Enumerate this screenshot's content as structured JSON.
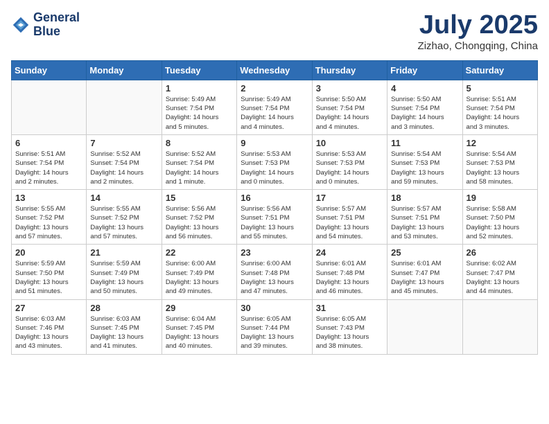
{
  "header": {
    "logo_line1": "General",
    "logo_line2": "Blue",
    "month": "July 2025",
    "location": "Zizhao, Chongqing, China"
  },
  "weekdays": [
    "Sunday",
    "Monday",
    "Tuesday",
    "Wednesday",
    "Thursday",
    "Friday",
    "Saturday"
  ],
  "weeks": [
    [
      {
        "day": "",
        "info": ""
      },
      {
        "day": "",
        "info": ""
      },
      {
        "day": "1",
        "info": "Sunrise: 5:49 AM\nSunset: 7:54 PM\nDaylight: 14 hours\nand 5 minutes."
      },
      {
        "day": "2",
        "info": "Sunrise: 5:49 AM\nSunset: 7:54 PM\nDaylight: 14 hours\nand 4 minutes."
      },
      {
        "day": "3",
        "info": "Sunrise: 5:50 AM\nSunset: 7:54 PM\nDaylight: 14 hours\nand 4 minutes."
      },
      {
        "day": "4",
        "info": "Sunrise: 5:50 AM\nSunset: 7:54 PM\nDaylight: 14 hours\nand 3 minutes."
      },
      {
        "day": "5",
        "info": "Sunrise: 5:51 AM\nSunset: 7:54 PM\nDaylight: 14 hours\nand 3 minutes."
      }
    ],
    [
      {
        "day": "6",
        "info": "Sunrise: 5:51 AM\nSunset: 7:54 PM\nDaylight: 14 hours\nand 2 minutes."
      },
      {
        "day": "7",
        "info": "Sunrise: 5:52 AM\nSunset: 7:54 PM\nDaylight: 14 hours\nand 2 minutes."
      },
      {
        "day": "8",
        "info": "Sunrise: 5:52 AM\nSunset: 7:54 PM\nDaylight: 14 hours\nand 1 minute."
      },
      {
        "day": "9",
        "info": "Sunrise: 5:53 AM\nSunset: 7:53 PM\nDaylight: 14 hours\nand 0 minutes."
      },
      {
        "day": "10",
        "info": "Sunrise: 5:53 AM\nSunset: 7:53 PM\nDaylight: 14 hours\nand 0 minutes."
      },
      {
        "day": "11",
        "info": "Sunrise: 5:54 AM\nSunset: 7:53 PM\nDaylight: 13 hours\nand 59 minutes."
      },
      {
        "day": "12",
        "info": "Sunrise: 5:54 AM\nSunset: 7:53 PM\nDaylight: 13 hours\nand 58 minutes."
      }
    ],
    [
      {
        "day": "13",
        "info": "Sunrise: 5:55 AM\nSunset: 7:52 PM\nDaylight: 13 hours\nand 57 minutes."
      },
      {
        "day": "14",
        "info": "Sunrise: 5:55 AM\nSunset: 7:52 PM\nDaylight: 13 hours\nand 57 minutes."
      },
      {
        "day": "15",
        "info": "Sunrise: 5:56 AM\nSunset: 7:52 PM\nDaylight: 13 hours\nand 56 minutes."
      },
      {
        "day": "16",
        "info": "Sunrise: 5:56 AM\nSunset: 7:51 PM\nDaylight: 13 hours\nand 55 minutes."
      },
      {
        "day": "17",
        "info": "Sunrise: 5:57 AM\nSunset: 7:51 PM\nDaylight: 13 hours\nand 54 minutes."
      },
      {
        "day": "18",
        "info": "Sunrise: 5:57 AM\nSunset: 7:51 PM\nDaylight: 13 hours\nand 53 minutes."
      },
      {
        "day": "19",
        "info": "Sunrise: 5:58 AM\nSunset: 7:50 PM\nDaylight: 13 hours\nand 52 minutes."
      }
    ],
    [
      {
        "day": "20",
        "info": "Sunrise: 5:59 AM\nSunset: 7:50 PM\nDaylight: 13 hours\nand 51 minutes."
      },
      {
        "day": "21",
        "info": "Sunrise: 5:59 AM\nSunset: 7:49 PM\nDaylight: 13 hours\nand 50 minutes."
      },
      {
        "day": "22",
        "info": "Sunrise: 6:00 AM\nSunset: 7:49 PM\nDaylight: 13 hours\nand 49 minutes."
      },
      {
        "day": "23",
        "info": "Sunrise: 6:00 AM\nSunset: 7:48 PM\nDaylight: 13 hours\nand 47 minutes."
      },
      {
        "day": "24",
        "info": "Sunrise: 6:01 AM\nSunset: 7:48 PM\nDaylight: 13 hours\nand 46 minutes."
      },
      {
        "day": "25",
        "info": "Sunrise: 6:01 AM\nSunset: 7:47 PM\nDaylight: 13 hours\nand 45 minutes."
      },
      {
        "day": "26",
        "info": "Sunrise: 6:02 AM\nSunset: 7:47 PM\nDaylight: 13 hours\nand 44 minutes."
      }
    ],
    [
      {
        "day": "27",
        "info": "Sunrise: 6:03 AM\nSunset: 7:46 PM\nDaylight: 13 hours\nand 43 minutes."
      },
      {
        "day": "28",
        "info": "Sunrise: 6:03 AM\nSunset: 7:45 PM\nDaylight: 13 hours\nand 41 minutes."
      },
      {
        "day": "29",
        "info": "Sunrise: 6:04 AM\nSunset: 7:45 PM\nDaylight: 13 hours\nand 40 minutes."
      },
      {
        "day": "30",
        "info": "Sunrise: 6:05 AM\nSunset: 7:44 PM\nDaylight: 13 hours\nand 39 minutes."
      },
      {
        "day": "31",
        "info": "Sunrise: 6:05 AM\nSunset: 7:43 PM\nDaylight: 13 hours\nand 38 minutes."
      },
      {
        "day": "",
        "info": ""
      },
      {
        "day": "",
        "info": ""
      }
    ]
  ]
}
